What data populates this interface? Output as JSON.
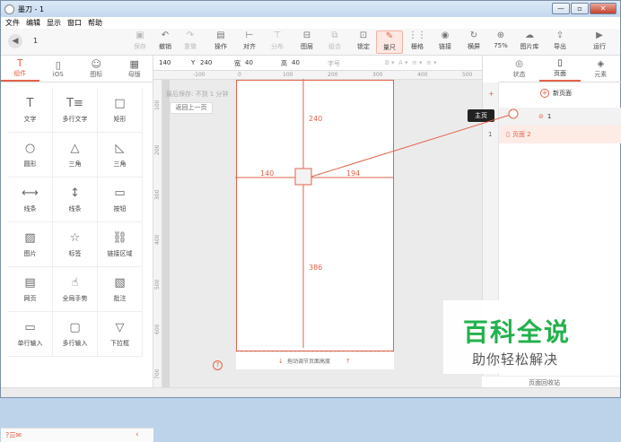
{
  "window": {
    "title": "墨刀 - 1",
    "controls": [
      "—",
      "▫",
      "✕"
    ]
  },
  "menu": [
    "文件",
    "编辑",
    "显示",
    "窗口",
    "帮助"
  ],
  "toolbar": {
    "back_icon": "◀",
    "page_number": "1",
    "tools": [
      {
        "name": "save",
        "icon": "▣",
        "label": "保存",
        "dim": true
      },
      {
        "name": "undo",
        "icon": "↶",
        "label": "撤销",
        "dim": false
      },
      {
        "name": "redo",
        "icon": "↷",
        "label": "重做",
        "dim": true
      },
      {
        "name": "operate",
        "icon": "▤",
        "label": "操作",
        "dim": false
      },
      {
        "name": "align",
        "icon": "⊢",
        "label": "对齐",
        "dim": false
      },
      {
        "name": "distribute",
        "icon": "⊤",
        "label": "分布",
        "dim": true
      },
      {
        "name": "layer",
        "icon": "⊟",
        "label": "图层",
        "dim": false
      },
      {
        "name": "group",
        "icon": "⧉",
        "label": "组合",
        "dim": true
      },
      {
        "name": "lock",
        "icon": "⊡",
        "label": "锁定",
        "dim": false
      },
      {
        "name": "ruler",
        "icon": "✎",
        "label": "量尺",
        "dim": false,
        "active": true
      },
      {
        "name": "grid",
        "icon": "⋮⋮",
        "label": "栅格",
        "dim": false
      },
      {
        "name": "link",
        "icon": "◉",
        "label": "链接",
        "dim": false
      },
      {
        "name": "landscape",
        "icon": "↻",
        "label": "横屏",
        "dim": false
      },
      {
        "name": "zoom",
        "icon": "⊕",
        "label": "75%",
        "dim": false
      },
      {
        "name": "image-library",
        "icon": "☁",
        "label": "图片库",
        "dim": false
      },
      {
        "name": "export",
        "icon": "⇪",
        "label": "导出",
        "dim": false
      },
      {
        "name": "run",
        "icon": "▶",
        "label": "运行",
        "dim": false
      }
    ]
  },
  "left_tabs": [
    {
      "icon": "T",
      "label": "组件",
      "active": true
    },
    {
      "icon": "▯",
      "label": "iOS",
      "active": false
    },
    {
      "icon": "☺",
      "label": "图标",
      "active": false
    },
    {
      "icon": "▦",
      "label": "母版",
      "active": false
    }
  ],
  "components": [
    {
      "icon": "T",
      "label": "文字"
    },
    {
      "icon": "T≡",
      "label": "多行文字"
    },
    {
      "icon": "□",
      "label": "矩形"
    },
    {
      "icon": "○",
      "label": "圆形"
    },
    {
      "icon": "△",
      "label": "三角"
    },
    {
      "icon": "◺",
      "label": "三角"
    },
    {
      "icon": "⟷",
      "label": "线条"
    },
    {
      "icon": "↕",
      "label": "线条"
    },
    {
      "icon": "▭",
      "label": "按钮"
    },
    {
      "icon": "▨",
      "label": "图片"
    },
    {
      "icon": "☆",
      "label": "标签"
    },
    {
      "icon": "⛓",
      "label": "链接区域"
    },
    {
      "icon": "▤",
      "label": "网页"
    },
    {
      "icon": "☝",
      "label": "全局手势"
    },
    {
      "icon": "▧",
      "label": "批注"
    },
    {
      "icon": "▭",
      "label": "单行输入"
    },
    {
      "icon": "▢",
      "label": "多行输入"
    },
    {
      "icon": "▽",
      "label": "下拉框"
    }
  ],
  "left_bottom": {
    "left_icons": "?☰✉",
    "collapse": "‹"
  },
  "props": {
    "x_value": "140",
    "y_label": "Y",
    "y_value": "240",
    "w_label": "宽",
    "w_value": "40",
    "h_label": "高",
    "h_value": "40",
    "font_label": "字号"
  },
  "canvas": {
    "hint": "最后保存: 不到 1 分钟",
    "back_button": "返回上一页",
    "ruler_h": [
      "-100",
      "0",
      "100",
      "200",
      "300",
      "400",
      "500"
    ],
    "ruler_v": [
      "100",
      "200",
      "300",
      "400",
      "500",
      "600",
      "700"
    ],
    "footer_hint": "拖动调节页面高度",
    "help": "?",
    "measure": {
      "top": "240",
      "left": "140",
      "right": "194",
      "bottom": "386"
    }
  },
  "right_tabs": [
    {
      "icon": "◎",
      "label": "状态",
      "active": false
    },
    {
      "icon": "▯",
      "label": "页面",
      "active": true
    },
    {
      "icon": "◈",
      "label": "元素",
      "active": false
    }
  ],
  "pages": {
    "new_page": "新页面",
    "plus_icon": "+",
    "gutter_plus": "+",
    "row1_num": "1",
    "row1_label": "1",
    "row2_num": "1",
    "row2_label": "页面 2",
    "tooltip": "主页",
    "recycle": "页面回收站"
  },
  "watermark": {
    "title": "百科全说",
    "subtitle": "助你轻松解决"
  },
  "colors": {
    "accent": "#e2634a",
    "watermark_green": "#22b14c"
  }
}
